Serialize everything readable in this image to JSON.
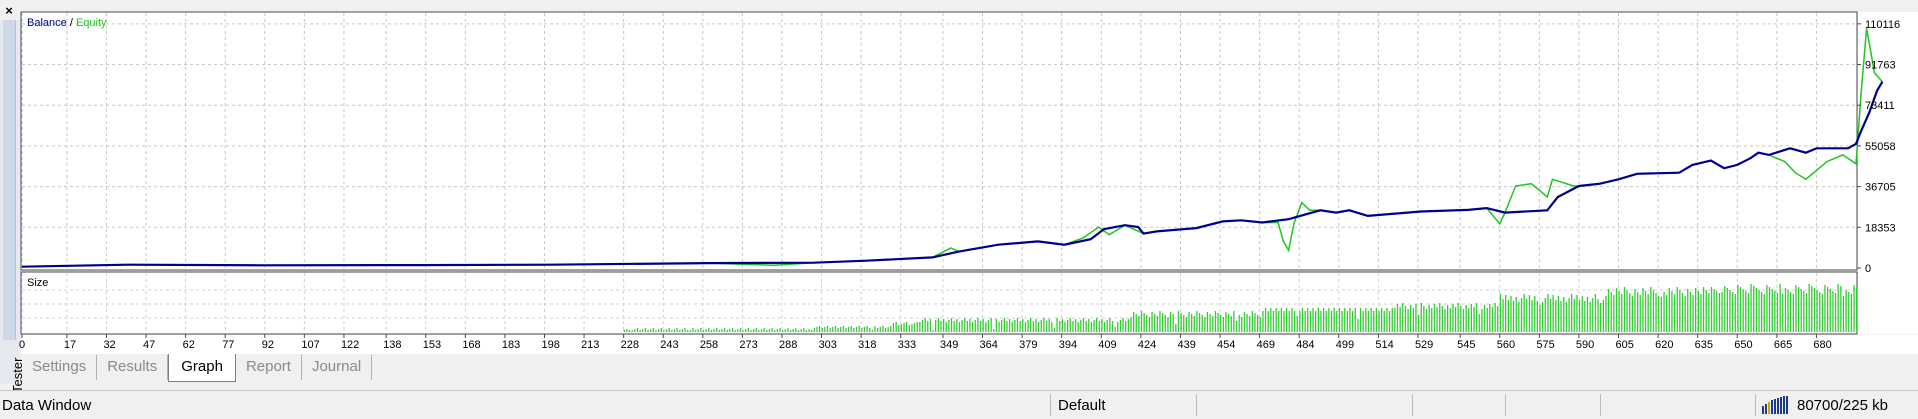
{
  "window": {
    "close_glyph": "×",
    "panel_title": "Tester"
  },
  "legend": {
    "balance": "Balance",
    "separator": " / ",
    "equity": "Equity"
  },
  "colors": {
    "balance": "#00008b",
    "equity": "#22c422",
    "bars": "#33cc33",
    "grid": "#c8c8c8",
    "frame": "#4a4a4a"
  },
  "tabs": [
    {
      "label": "Settings",
      "active": false
    },
    {
      "label": "Results",
      "active": false
    },
    {
      "label": "Graph",
      "active": true
    },
    {
      "label": "Report",
      "active": false
    },
    {
      "label": "Journal",
      "active": false
    }
  ],
  "status": {
    "left": "Data Window",
    "profile": "Default",
    "traffic": "80700/225 kb",
    "traffic_icon": "connection-bars-icon"
  },
  "chart_data": [
    {
      "type": "line",
      "y_ticks": [
        0,
        18353,
        36705,
        55058,
        73411,
        91763,
        110116
      ],
      "ylim": [
        0,
        115000
      ],
      "xlim": [
        0,
        695
      ],
      "grid": true,
      "legend_position": "top-left",
      "series": [
        {
          "name": "Balance",
          "color": "#00008b",
          "points": [
            [
              0,
              600
            ],
            [
              40,
              1500
            ],
            [
              90,
              1200
            ],
            [
              150,
              1300
            ],
            [
              200,
              1500
            ],
            [
              260,
              2200
            ],
            [
              300,
              2400
            ],
            [
              320,
              3300
            ],
            [
              345,
              4800
            ],
            [
              355,
              7400
            ],
            [
              370,
              10500
            ],
            [
              385,
              12000
            ],
            [
              395,
              10500
            ],
            [
              405,
              13000
            ],
            [
              410,
              17500
            ],
            [
              418,
              19300
            ],
            [
              423,
              18500
            ],
            [
              425,
              15500
            ],
            [
              430,
              16500
            ],
            [
              445,
              18000
            ],
            [
              455,
              21000
            ],
            [
              462,
              21500
            ],
            [
              470,
              20500
            ],
            [
              480,
              22000
            ],
            [
              492,
              26000
            ],
            [
              498,
              25000
            ],
            [
              503,
              26000
            ],
            [
              510,
              23500
            ],
            [
              530,
              25500
            ],
            [
              548,
              26200
            ],
            [
              555,
              27000
            ],
            [
              562,
              25000
            ],
            [
              578,
              26000
            ],
            [
              582,
              32000
            ],
            [
              590,
              37000
            ],
            [
              598,
              38000
            ],
            [
              605,
              40000
            ],
            [
              612,
              42500
            ],
            [
              628,
              43000
            ],
            [
              633,
              46500
            ],
            [
              640,
              48500
            ],
            [
              645,
              45000
            ],
            [
              650,
              46500
            ],
            [
              655,
              49500
            ],
            [
              658,
              52000
            ],
            [
              662,
              51000
            ],
            [
              670,
              54000
            ],
            [
              676,
              52000
            ],
            [
              680,
              54000
            ],
            [
              692,
              54000
            ],
            [
              695,
              56000
            ],
            [
              697,
              62000
            ],
            [
              700,
              70000
            ],
            [
              703,
              80000
            ],
            [
              705,
              84000
            ]
          ]
        },
        {
          "name": "Equity",
          "color": "#22c422",
          "points": [
            [
              0,
              600
            ],
            [
              40,
              1500
            ],
            [
              90,
              1200
            ],
            [
              150,
              1300
            ],
            [
              200,
              1500
            ],
            [
              260,
              2200
            ],
            [
              285,
              1200
            ],
            [
              300,
              2400
            ],
            [
              320,
              3300
            ],
            [
              345,
              4800
            ],
            [
              352,
              9000
            ],
            [
              355,
              7400
            ],
            [
              370,
              10500
            ],
            [
              385,
              12000
            ],
            [
              395,
              10500
            ],
            [
              402,
              13500
            ],
            [
              408,
              18500
            ],
            [
              412,
              15000
            ],
            [
              418,
              19300
            ],
            [
              425,
              15500
            ],
            [
              430,
              16500
            ],
            [
              445,
              18000
            ],
            [
              455,
              21000
            ],
            [
              462,
              21500
            ],
            [
              470,
              20500
            ],
            [
              476,
              20500
            ],
            [
              478,
              12000
            ],
            [
              480,
              8000
            ],
            [
              482,
              20000
            ],
            [
              485,
              29500
            ],
            [
              488,
              26000
            ],
            [
              492,
              26000
            ],
            [
              498,
              25000
            ],
            [
              503,
              26000
            ],
            [
              510,
              23500
            ],
            [
              530,
              25500
            ],
            [
              548,
              26200
            ],
            [
              555,
              27000
            ],
            [
              560,
              20000
            ],
            [
              562,
              25000
            ],
            [
              566,
              37000
            ],
            [
              572,
              38000
            ],
            [
              578,
              32000
            ],
            [
              580,
              40000
            ],
            [
              588,
              37000
            ],
            [
              592,
              37000
            ],
            [
              598,
              38000
            ],
            [
              605,
              40000
            ],
            [
              612,
              42500
            ],
            [
              628,
              43000
            ],
            [
              633,
              46500
            ],
            [
              640,
              48500
            ],
            [
              645,
              45000
            ],
            [
              650,
              46500
            ],
            [
              655,
              49500
            ],
            [
              658,
              52000
            ],
            [
              662,
              51000
            ],
            [
              668,
              48000
            ],
            [
              672,
              43000
            ],
            [
              676,
              40000
            ],
            [
              684,
              48000
            ],
            [
              690,
              51000
            ],
            [
              695,
              47000
            ],
            [
              697,
              80000
            ],
            [
              699,
              108000
            ],
            [
              702,
              88000
            ],
            [
              705,
              84000
            ]
          ]
        }
      ]
    },
    {
      "type": "bar",
      "title": "Size",
      "x_ticks": [
        0,
        17,
        32,
        47,
        62,
        77,
        92,
        107,
        122,
        138,
        153,
        168,
        183,
        198,
        213,
        228,
        243,
        258,
        273,
        288,
        303,
        318,
        333,
        349,
        364,
        379,
        394,
        409,
        424,
        439,
        454,
        469,
        484,
        499,
        514,
        529,
        545,
        560,
        575,
        590,
        605,
        620,
        635,
        650,
        665,
        680
      ],
      "xlim": [
        0,
        695
      ],
      "ylim": [
        0,
        1
      ],
      "grid": true,
      "values_note": "",
      "series": [
        {
          "name": "Size",
          "color": "#33cc33",
          "values": "bars"
        }
      ]
    }
  ]
}
